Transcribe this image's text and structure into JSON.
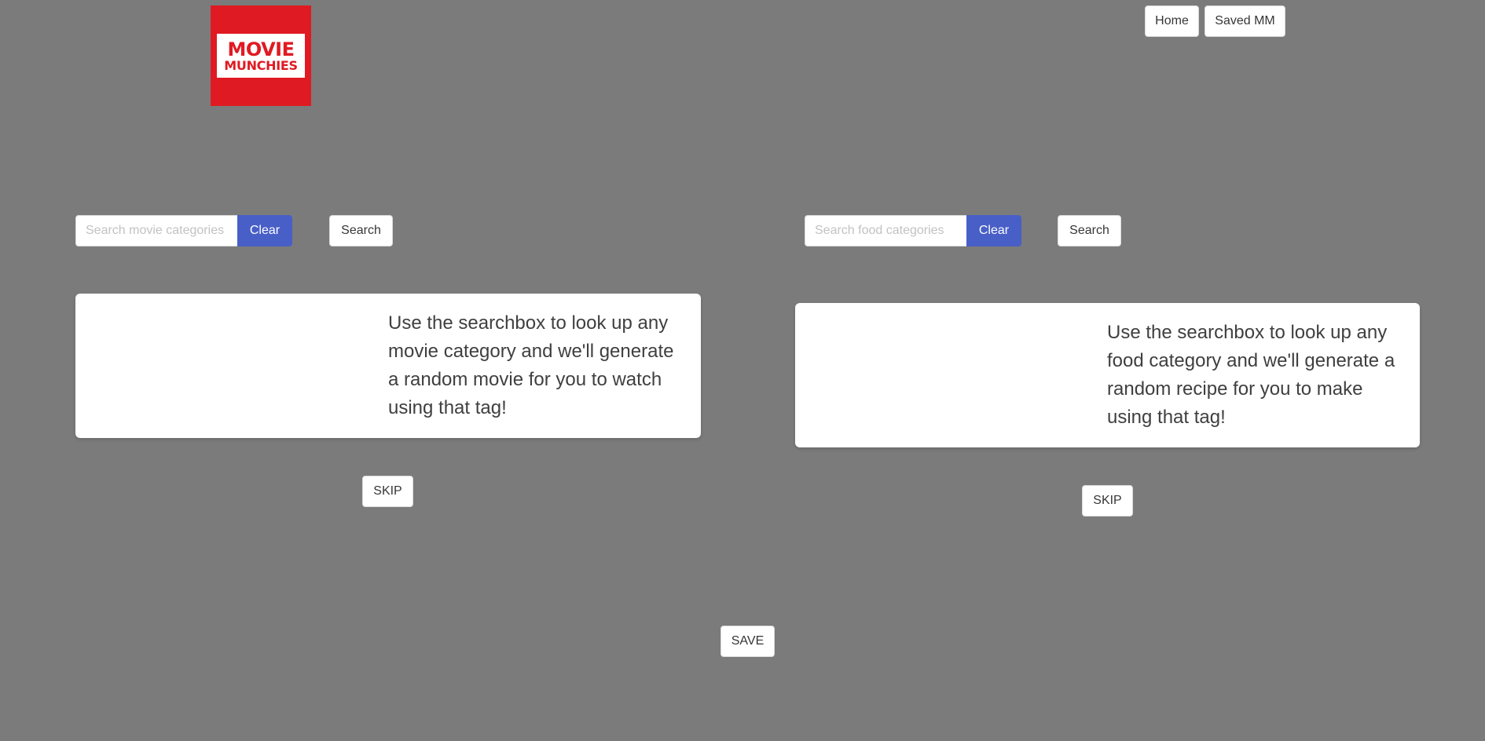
{
  "logo": {
    "line1": "MOVIE",
    "line2": "MUNCHIES",
    "color": "#e01a22"
  },
  "nav": {
    "home_label": "Home",
    "saved_label": "Saved MM"
  },
  "movie": {
    "search_placeholder": "Search movie categories",
    "search_value": "",
    "clear_label": "Clear",
    "search_label": "Search",
    "card_text": "Use the searchbox to look up any movie category and we'll generate a random movie for you to watch using that tag!",
    "skip_label": "SKIP"
  },
  "food": {
    "search_placeholder": "Search food categories",
    "search_value": "",
    "clear_label": "Clear",
    "search_label": "Search",
    "card_text": "Use the searchbox to look up any food category and we'll generate a random recipe for you to make using that tag!",
    "skip_label": "SKIP"
  },
  "save_label": "SAVE",
  "colors": {
    "background": "#7b7b7b",
    "accent": "#485fc7",
    "brand": "#e01a22"
  }
}
